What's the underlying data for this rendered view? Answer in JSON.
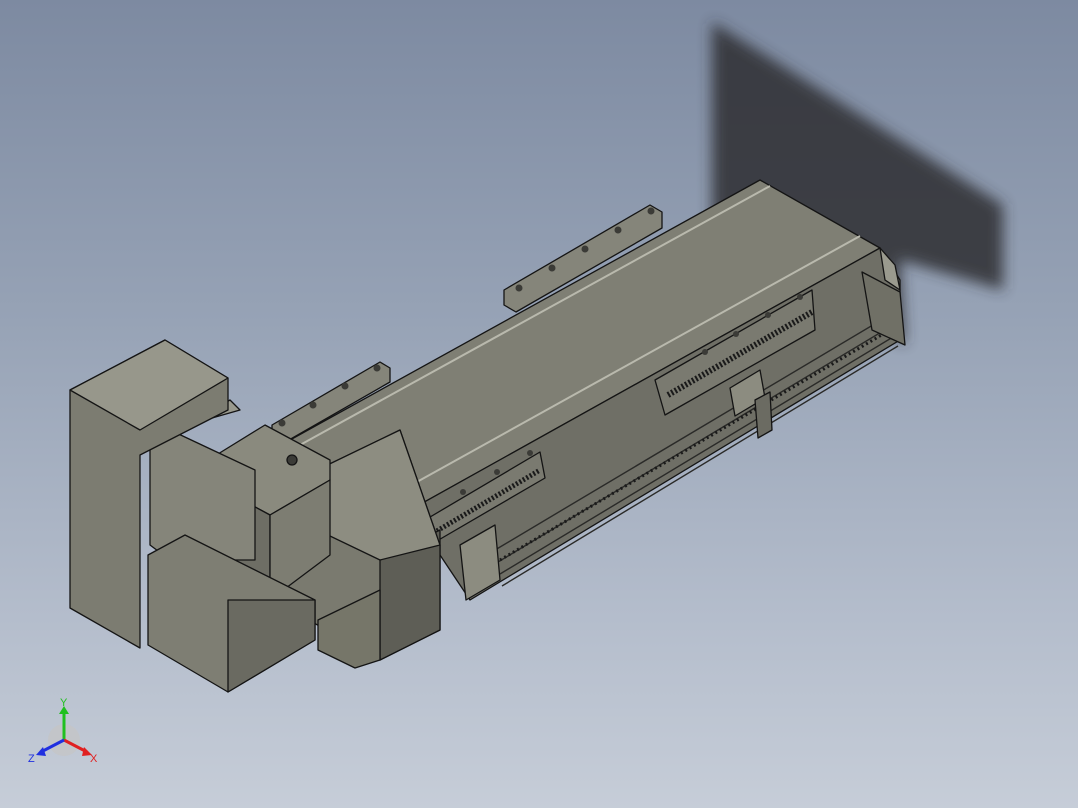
{
  "viewport": {
    "background_top": "#7d8aa1",
    "background_bottom": "#c6cdd8",
    "model_color": "#8a8a7c"
  },
  "triad": {
    "x_label": "X",
    "y_label": "Y",
    "z_label": "Z",
    "x_color": "#e02020",
    "y_color": "#20c020",
    "z_color": "#2030e0"
  }
}
